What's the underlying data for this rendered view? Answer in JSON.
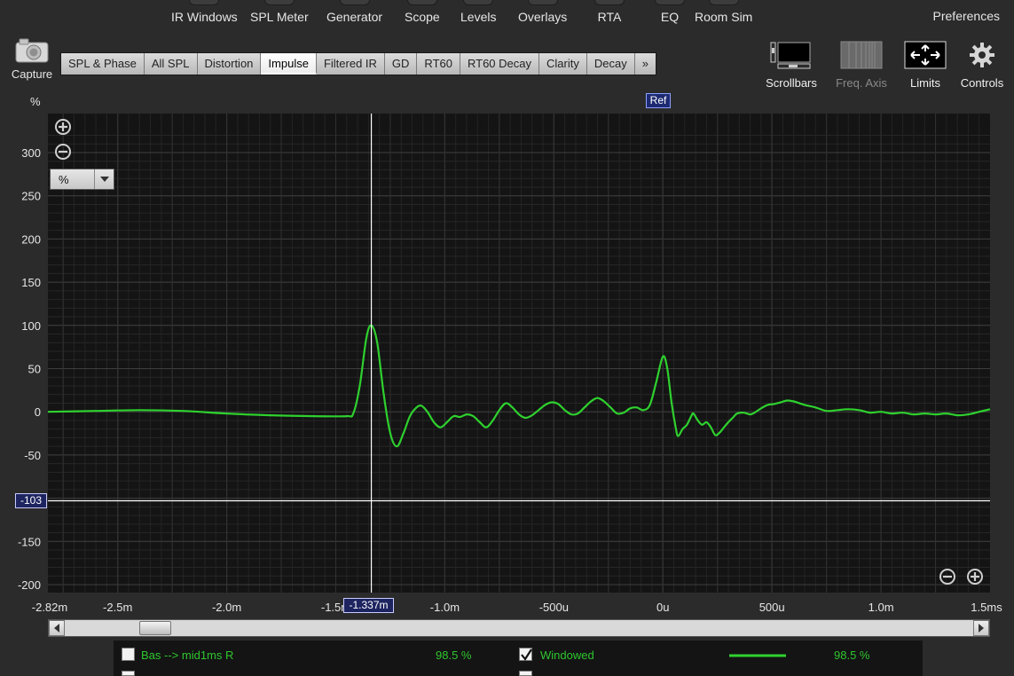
{
  "menu": {
    "items": [
      "IR Windows",
      "SPL Meter",
      "Generator",
      "Scope",
      "Levels",
      "Overlays",
      "RTA",
      "EQ",
      "Room Sim"
    ],
    "preferences": "Preferences"
  },
  "capture_label": "Capture",
  "tabs": [
    "SPL & Phase",
    "All SPL",
    "Distortion",
    "Impulse",
    "Filtered IR",
    "GD",
    "RT60",
    "RT60 Decay",
    "Clarity",
    "Decay",
    "»"
  ],
  "active_tab": "Impulse",
  "tools": {
    "scrollbars": "Scrollbars",
    "freq_axis": "Freq. Axis",
    "limits": "Limits",
    "controls": "Controls"
  },
  "y_unit_label": "%",
  "unit_dropdown": "%",
  "markers": {
    "ref": "Ref",
    "cursor_y": "-103",
    "cursor_x": "-1.337m"
  },
  "legend": {
    "measurement_name": "Bas --> mid1ms R",
    "measurement_value": "98.5 %",
    "windowed_label": "Windowed",
    "windowed_checked": true,
    "windowed_value": "98.5 %"
  },
  "colors": {
    "trace": "#2ed12e",
    "background": "#141414",
    "ref_marker": "#1d2a72",
    "cursor": "#ffffff"
  },
  "chart_data": {
    "type": "line",
    "xlim": [
      -0.00282,
      0.0015
    ],
    "ylim": [
      -200,
      300
    ],
    "grid": true,
    "ylabel": "%",
    "yticks": [
      300,
      250,
      200,
      150,
      100,
      50,
      0,
      -50,
      -150,
      -200
    ],
    "xticks": [
      {
        "v": -0.00282,
        "label": "-2.82m"
      },
      {
        "v": -0.0025,
        "label": "-2.5m"
      },
      {
        "v": -0.002,
        "label": "-2.0m"
      },
      {
        "v": -0.0015,
        "label": "-1.5m"
      },
      {
        "v": -0.001,
        "label": "-1.0m"
      },
      {
        "v": -0.0005,
        "label": "-500u"
      },
      {
        "v": 0,
        "label": "0u"
      },
      {
        "v": 0.0005,
        "label": "500u"
      },
      {
        "v": 0.001,
        "label": "1.0m"
      },
      {
        "v": 0.0015,
        "label": "1.5ms"
      }
    ],
    "cursor": {
      "x": -0.001337,
      "y": -103
    },
    "ref_x": 0,
    "series": [
      {
        "name": "Bas --> mid1ms R",
        "points": [
          [
            -0.00282,
            0
          ],
          [
            -0.0026,
            1
          ],
          [
            -0.0024,
            2
          ],
          [
            -0.0022,
            1
          ],
          [
            -0.002,
            -2
          ],
          [
            -0.0018,
            -4
          ],
          [
            -0.0016,
            -5
          ],
          [
            -0.00145,
            -5
          ],
          [
            -0.00142,
            -2
          ],
          [
            -0.00139,
            30
          ],
          [
            -0.00136,
            85
          ],
          [
            -0.001337,
            100
          ],
          [
            -0.00131,
            80
          ],
          [
            -0.00128,
            20
          ],
          [
            -0.00125,
            -25
          ],
          [
            -0.00122,
            -40
          ],
          [
            -0.00119,
            -25
          ],
          [
            -0.00116,
            -5
          ],
          [
            -0.00113,
            5
          ],
          [
            -0.001107,
            7
          ],
          [
            -0.00108,
            0
          ],
          [
            -0.00105,
            -12
          ],
          [
            -0.00102,
            -18
          ],
          [
            -0.00099,
            -12
          ],
          [
            -0.00096,
            -5
          ],
          [
            -0.00093,
            -6
          ],
          [
            -0.0009,
            -3
          ],
          [
            -0.00087,
            -5
          ],
          [
            -0.00084,
            -12
          ],
          [
            -0.00081,
            -18
          ],
          [
            -0.00078,
            -10
          ],
          [
            -0.00075,
            2
          ],
          [
            -0.00072,
            10
          ],
          [
            -0.00069,
            5
          ],
          [
            -0.00066,
            -3
          ],
          [
            -0.00063,
            -7
          ],
          [
            -0.0006,
            -4
          ],
          [
            -0.00057,
            2
          ],
          [
            -0.00054,
            8
          ],
          [
            -0.00051,
            11
          ],
          [
            -0.00048,
            9
          ],
          [
            -0.00045,
            2
          ],
          [
            -0.00042,
            -3
          ],
          [
            -0.00039,
            -2
          ],
          [
            -0.00036,
            5
          ],
          [
            -0.00033,
            12
          ],
          [
            -0.0003,
            16
          ],
          [
            -0.00027,
            12
          ],
          [
            -0.00024,
            5
          ],
          [
            -0.00021,
            -2
          ],
          [
            -0.00018,
            -1
          ],
          [
            -0.00015,
            4
          ],
          [
            -0.00012,
            5
          ],
          [
            -9e-05,
            2
          ],
          [
            -6e-05,
            8
          ],
          [
            -3e-05,
            35
          ],
          [
            0,
            64
          ],
          [
            2e-05,
            50
          ],
          [
            4e-05,
            10
          ],
          [
            6e-05,
            -20
          ],
          [
            7e-05,
            -28
          ],
          [
            9e-05,
            -20
          ],
          [
            0.00011,
            -15
          ],
          [
            0.00013,
            -5
          ],
          [
            0.00014,
            -2
          ],
          [
            0.00016,
            -10
          ],
          [
            0.00018,
            -15
          ],
          [
            0.0002,
            -12
          ],
          [
            0.00022,
            -18
          ],
          [
            0.00024,
            -27
          ],
          [
            0.00026,
            -24
          ],
          [
            0.00028,
            -18
          ],
          [
            0.0003,
            -12
          ],
          [
            0.00032,
            -7
          ],
          [
            0.00034,
            -2
          ],
          [
            0.00037,
            -1
          ],
          [
            0.0004,
            -3
          ],
          [
            0.00042,
            -1
          ],
          [
            0.00045,
            4
          ],
          [
            0.00048,
            8
          ],
          [
            0.00051,
            9
          ],
          [
            0.00054,
            11
          ],
          [
            0.00057,
            13
          ],
          [
            0.0006,
            12
          ],
          [
            0.00065,
            8
          ],
          [
            0.0007,
            5
          ],
          [
            0.00075,
            1
          ],
          [
            0.0008,
            2
          ],
          [
            0.00085,
            3
          ],
          [
            0.0009,
            2
          ],
          [
            0.00095,
            -1
          ],
          [
            0.001,
            0
          ],
          [
            0.00105,
            -2
          ],
          [
            0.0011,
            -1
          ],
          [
            0.00115,
            -3
          ],
          [
            0.0012,
            -2
          ],
          [
            0.00125,
            -3
          ],
          [
            0.0013,
            -2
          ],
          [
            0.00135,
            -4
          ],
          [
            0.0014,
            -3
          ],
          [
            0.00145,
            0
          ],
          [
            0.0015,
            3
          ]
        ]
      }
    ]
  }
}
